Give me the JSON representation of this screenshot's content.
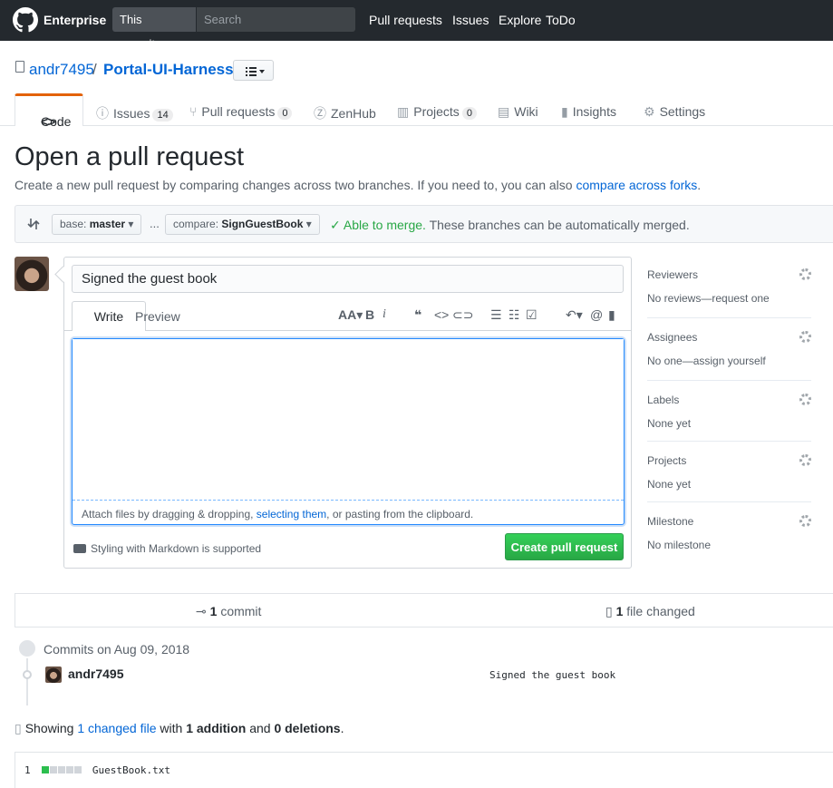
{
  "header": {
    "brand": "Enterprise",
    "scope": "This repository",
    "search_placeholder": "Search",
    "nav": [
      "Pull requests",
      "Issues",
      "Explore",
      "ToDo"
    ]
  },
  "repo": {
    "owner": "andr7495",
    "name": "Portal-UI-Harness"
  },
  "tabs": [
    {
      "label": "Code"
    },
    {
      "label": "Issues",
      "count": "14"
    },
    {
      "label": "Pull requests",
      "count": "0"
    },
    {
      "label": "ZenHub"
    },
    {
      "label": "Projects",
      "count": "0"
    },
    {
      "label": "Wiki"
    },
    {
      "label": "Insights"
    },
    {
      "label": "Settings"
    }
  ],
  "page": {
    "title": "Open a pull request",
    "subtitle": "Create a new pull request by comparing changes across two branches. If you need to, you can also",
    "subtitle_link": "compare across forks",
    "subtitle_end": "."
  },
  "range": {
    "base_label": "base:",
    "base": "master",
    "ellipsis": "...",
    "compare_label": "compare:",
    "compare": "SignGuestBook",
    "merge_status": "Able to merge.",
    "merge_text": "These branches can be automatically merged."
  },
  "composer": {
    "title_value": "Signed the guest book",
    "write_tab": "Write",
    "preview_tab": "Preview",
    "body_value": "",
    "attach_text_1": "Attach files by dragging & dropping, ",
    "attach_link": "selecting them",
    "attach_text_2": ", or pasting from the clipboard.",
    "markdown_note": "Styling with Markdown is supported",
    "create_button": "Create pull request"
  },
  "sidebar": [
    {
      "heading": "Reviewers",
      "value": "No reviews—request one"
    },
    {
      "heading": "Assignees",
      "value": "No one—assign yourself"
    },
    {
      "heading": "Labels",
      "value": "None yet"
    },
    {
      "heading": "Projects",
      "value": "None yet"
    },
    {
      "heading": "Milestone",
      "value": "No milestone"
    }
  ],
  "summary": {
    "commits_count": "1",
    "commits_label": "commit",
    "files_count": "1",
    "files_label": "file changed"
  },
  "commits": {
    "date_heading": "Commits on Aug 09, 2018",
    "items": [
      {
        "author": "andr7495",
        "message": "Signed the guest book"
      }
    ]
  },
  "diff": {
    "showing_prefix": "Showing ",
    "changed_files_link": "1 changed file",
    "with": " with ",
    "additions": "1 addition",
    "and": " and ",
    "deletions": "0 deletions",
    "end": ".",
    "files": [
      {
        "count": "1",
        "name": "GuestBook.txt",
        "additions": 1,
        "deletions": 0
      }
    ]
  },
  "colors": {
    "header_bg": "#24292e",
    "link": "#0366d6",
    "tab_accent": "#e36209",
    "success": "#28a745"
  }
}
